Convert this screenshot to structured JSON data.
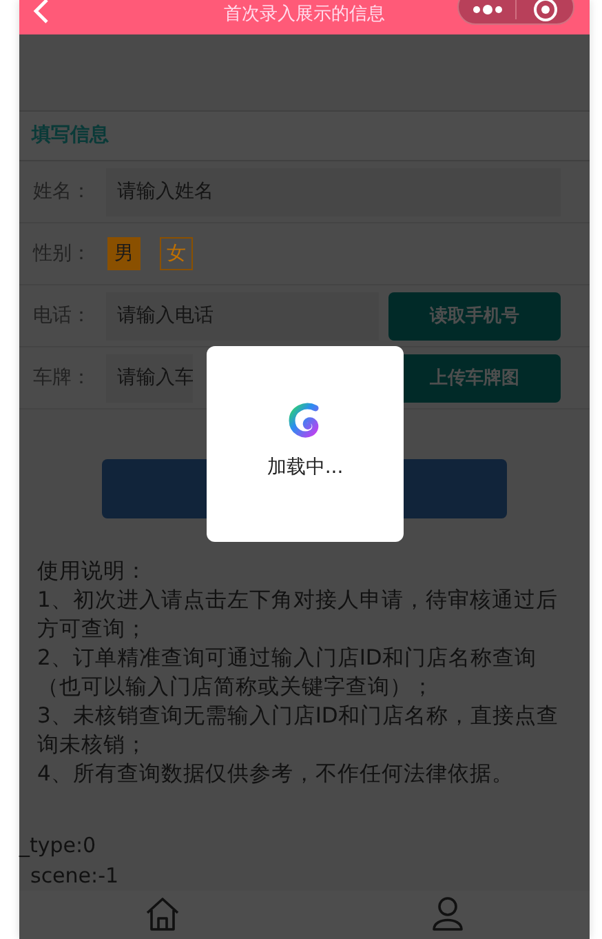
{
  "nav_bar": {
    "title": "首次录入展示的信息"
  },
  "section": {
    "title": "填写信息"
  },
  "form_rows": [
    {
      "kind": "input",
      "label": "姓名：",
      "placeholder": "请输入姓名"
    },
    {
      "kind": "choice",
      "label": "性别：",
      "options": [
        {
          "label": "男",
          "selected": true
        },
        {
          "label": "女",
          "selected": false
        }
      ]
    },
    {
      "kind": "input_button",
      "label": "电话：",
      "placeholder": "请输入电话",
      "button": "读取手机号"
    },
    {
      "kind": "input_button",
      "label": "车牌：",
      "placeholder": "请输入车",
      "button": "上传车牌图"
    }
  ],
  "loading_toast": {
    "text": "加载中..."
  },
  "instructions": [
    "使用说明：",
    "1、初次进入请点击左下角对接人申请，待审核通过后方可查询；",
    "2、订单精准查询可通过输入门店ID和门店名称查询（也可以输入门店简称或关键字查询）；",
    "3、未核销查询无需输入门店ID和门店名称，直接点查询未核销；",
    "4、所有查询数据仅供参考，不作任何法律依据。"
  ],
  "debug_lines": [
    "_type:0",
    "scene:-1"
  ],
  "tab_bar": [
    {
      "kind": "home"
    },
    {
      "kind": "user"
    }
  ]
}
